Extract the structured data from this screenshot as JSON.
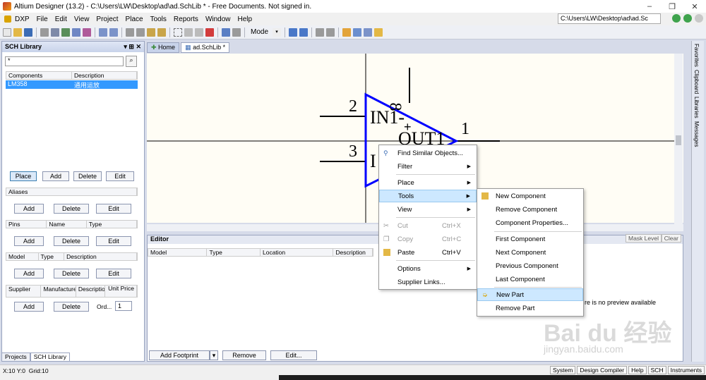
{
  "window": {
    "title": "Altium Designer (13.2) - C:\\Users\\LW\\Desktop\\ad\\ad.SchLib * - Free Documents. Not signed in.",
    "min": "–",
    "max": "❐",
    "close": "✕"
  },
  "menu": {
    "items": [
      "DXP",
      "File",
      "Edit",
      "View",
      "Project",
      "Place",
      "Tools",
      "Reports",
      "Window",
      "Help"
    ],
    "path": "C:\\Users\\LW\\Desktop\\ad\\ad.Sc"
  },
  "toolbar": {
    "mode_label": "Mode"
  },
  "sch_library": {
    "title": "SCH Library",
    "pin_glyph": "▾ ⊞ ✕",
    "filter_value": "*",
    "components_header": [
      "Components",
      "Description"
    ],
    "components": [
      {
        "name": "LM358",
        "description": "通用运放"
      }
    ],
    "component_buttons": [
      "Place",
      "Add",
      "Delete",
      "Edit"
    ],
    "aliases_header": "Aliases",
    "alias_buttons": [
      "Add",
      "Delete",
      "Edit"
    ],
    "pins_header": [
      "Pins",
      "Name",
      "Type"
    ],
    "pin_buttons": [
      "Add",
      "Delete",
      "Edit"
    ],
    "model_header": [
      "Model",
      "Type",
      "Description"
    ],
    "model_buttons": [
      "Add",
      "Delete",
      "Edit"
    ],
    "supplier_header": [
      "Supplier",
      "Manufacturer",
      "Description",
      "Unit Price"
    ],
    "supplier_buttons": [
      "Add",
      "Delete"
    ],
    "order_label": "Ord...",
    "order_value": "1",
    "bottom_tabs": [
      "Projects",
      "SCH Library"
    ]
  },
  "doc_tabs": [
    "Home",
    "ad.SchLib *"
  ],
  "schematic": {
    "pin2": "2",
    "pin3": "3",
    "pin1": "1",
    "pin8": "8",
    "label_in_minus": "IN1-",
    "label_out": "OUT1",
    "label_in_plus": "I",
    "cursor": "+"
  },
  "editor": {
    "title": "Editor",
    "mask_level": "Mask Level",
    "clear": "Clear",
    "columns": [
      "Model",
      "Type",
      "Location",
      "Description"
    ],
    "buttons": [
      "Add Footprint",
      "Remove",
      "Edit..."
    ],
    "preview_text": "re is no preview available"
  },
  "right_strip": [
    "Favorites",
    "Clipboard",
    "Libraries",
    "Messages"
  ],
  "context_menu": {
    "items": [
      {
        "label": "Find Similar Objects...",
        "shortcut": "",
        "submenu": false,
        "disabled": false
      },
      {
        "label": "Filter",
        "shortcut": "",
        "submenu": true,
        "disabled": false
      },
      {
        "label": "Place",
        "shortcut": "",
        "submenu": true,
        "disabled": false
      },
      {
        "label": "Tools",
        "shortcut": "",
        "submenu": true,
        "disabled": false,
        "highlighted": true
      },
      {
        "label": "View",
        "shortcut": "",
        "submenu": true,
        "disabled": false
      },
      {
        "label": "Cut",
        "shortcut": "Ctrl+X",
        "submenu": false,
        "disabled": true
      },
      {
        "label": "Copy",
        "shortcut": "Ctrl+C",
        "submenu": false,
        "disabled": true
      },
      {
        "label": "Paste",
        "shortcut": "Ctrl+V",
        "submenu": false,
        "disabled": false
      },
      {
        "label": "Options",
        "shortcut": "",
        "submenu": true,
        "disabled": false
      },
      {
        "label": "Supplier Links...",
        "shortcut": "",
        "submenu": false,
        "disabled": false
      }
    ]
  },
  "tools_submenu": {
    "items": [
      "New Component",
      "Remove Component",
      "Component Properties...",
      "First Component",
      "Next Component",
      "Previous Component",
      "Last Component",
      "New Part",
      "Remove Part"
    ],
    "highlighted": "New Part"
  },
  "status": {
    "coords": "X:10 Y:0",
    "grid": "Grid:10",
    "buttons": [
      "System",
      "Design Compiler",
      "Help",
      "SCH",
      "Instruments"
    ]
  },
  "watermark": {
    "brand": "Bai du 经验",
    "url": "jingyan.baidu.com"
  },
  "colors": {
    "selection": "#3399ff",
    "symbol": "#0000ff",
    "menu_highlight": "#cde8ff"
  }
}
